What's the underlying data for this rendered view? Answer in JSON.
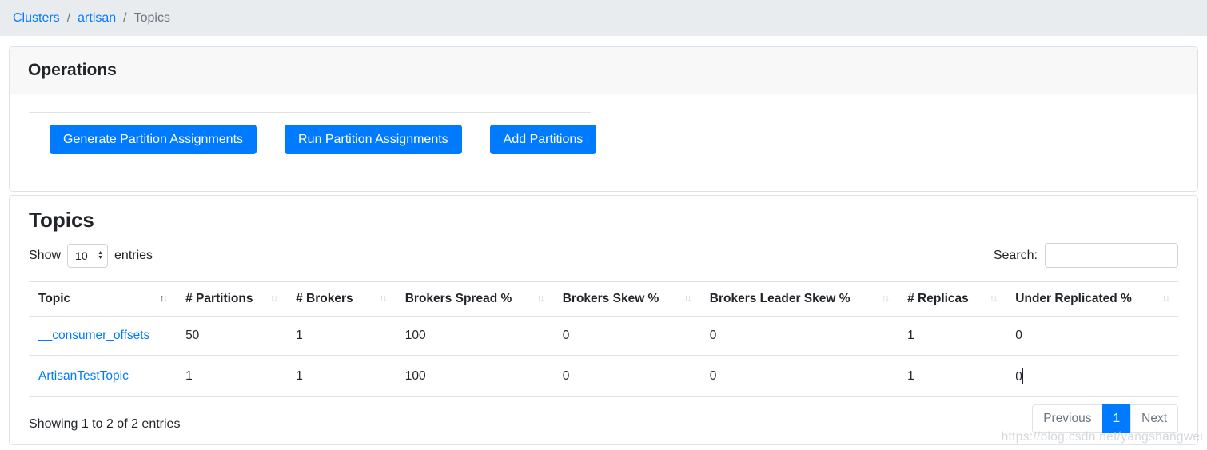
{
  "breadcrumb": {
    "separator": "/",
    "items": [
      {
        "label": "Clusters",
        "type": "link"
      },
      {
        "label": "artisan",
        "type": "link"
      },
      {
        "label": "Topics",
        "type": "current"
      }
    ]
  },
  "operations": {
    "title": "Operations",
    "buttons": [
      "Generate Partition Assignments",
      "Run Partition Assignments",
      "Add Partitions"
    ]
  },
  "topics": {
    "title": "Topics",
    "show_label": "Show",
    "entries_label": "entries",
    "page_size": "10",
    "search_label": "Search:",
    "search_value": "",
    "table": {
      "columns": [
        {
          "label": "Topic",
          "sort": "asc"
        },
        {
          "label": "# Partitions",
          "sort": "none"
        },
        {
          "label": "# Brokers",
          "sort": "none"
        },
        {
          "label": "Brokers Spread %",
          "sort": "none"
        },
        {
          "label": "Brokers Skew %",
          "sort": "none"
        },
        {
          "label": "Brokers Leader Skew %",
          "sort": "none"
        },
        {
          "label": "# Replicas",
          "sort": "none"
        },
        {
          "label": "Under Replicated %",
          "sort": "none"
        }
      ],
      "rows": [
        {
          "cells": [
            "__consumer_offsets",
            "50",
            "1",
            "100",
            "0",
            "0",
            "1",
            "0"
          ],
          "caret": false
        },
        {
          "cells": [
            "ArtisanTestTopic",
            "1",
            "1",
            "100",
            "0",
            "0",
            "1",
            "0"
          ],
          "caret": true
        }
      ]
    },
    "summary": "Showing 1 to 2 of 2 entries",
    "pagination": {
      "previous": "Previous",
      "pages": [
        "1"
      ],
      "active_page": "1",
      "next": "Next"
    }
  },
  "watermark": "https://blog.csdn.net/yangshangwei",
  "colors": {
    "primary": "#007bff",
    "link": "#007bff",
    "muted": "#6c757d",
    "border": "#dee2e6"
  }
}
